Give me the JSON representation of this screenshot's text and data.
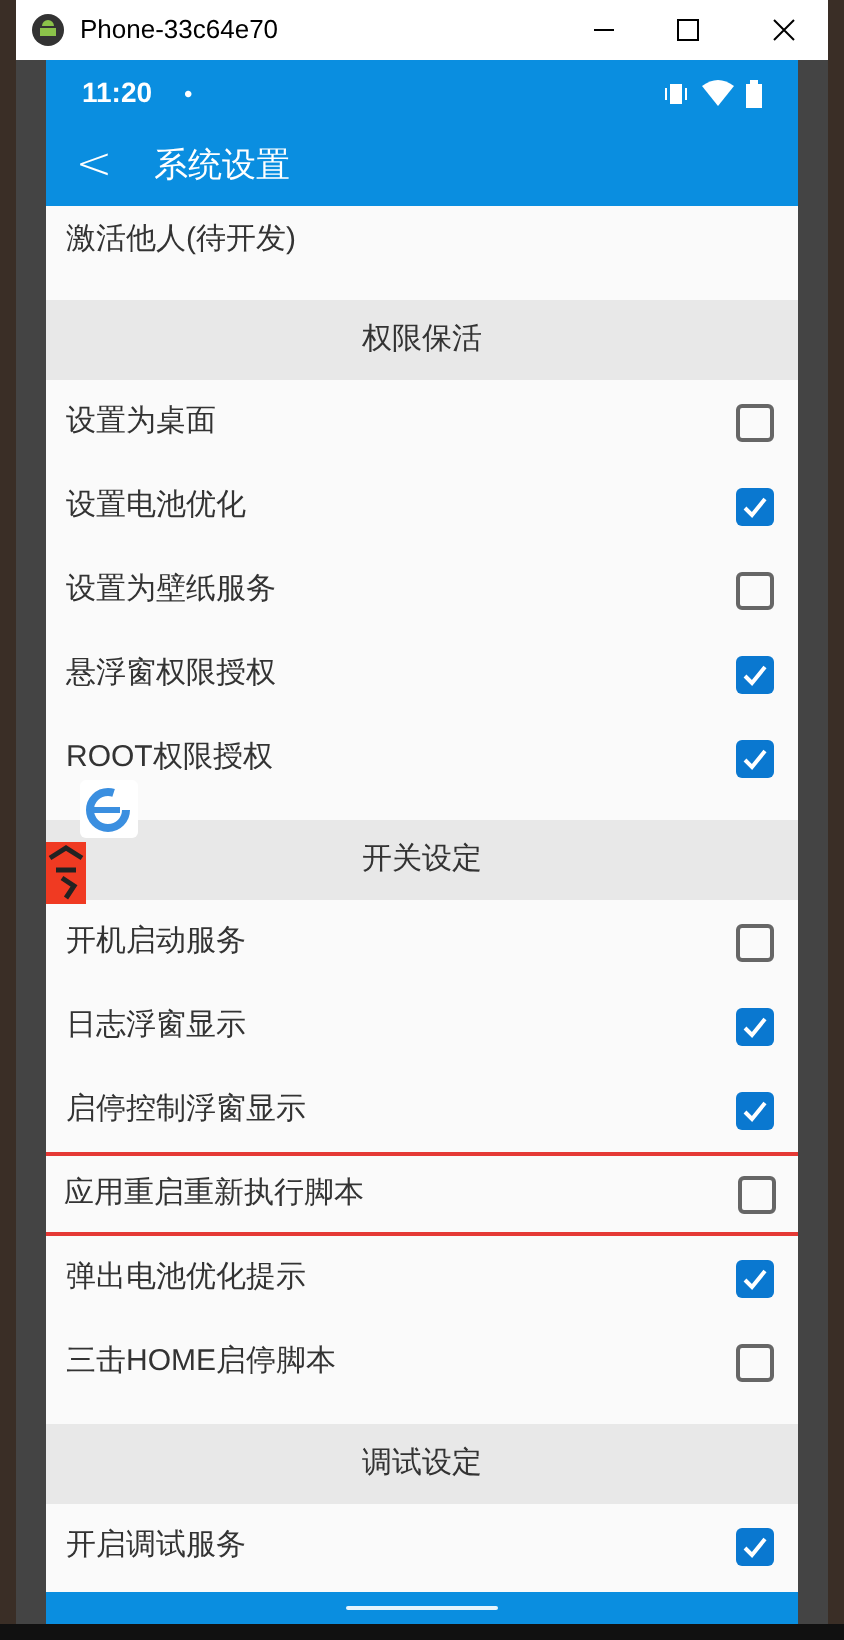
{
  "window": {
    "title": "Phone-33c64e70"
  },
  "status_bar": {
    "time": "11:20",
    "dot": "•"
  },
  "app_bar": {
    "back": "<",
    "title": "系统设置"
  },
  "top_item": {
    "label": "激活他人(待开发)"
  },
  "sections": [
    {
      "title": "权限保活",
      "items": [
        {
          "label": "设置为桌面",
          "checked": false,
          "highlighted": false
        },
        {
          "label": "设置电池优化",
          "checked": true,
          "highlighted": false
        },
        {
          "label": "设置为壁纸服务",
          "checked": false,
          "highlighted": false
        },
        {
          "label": "悬浮窗权限授权",
          "checked": true,
          "highlighted": false
        },
        {
          "label": "ROOT权限授权",
          "checked": true,
          "highlighted": false
        }
      ]
    },
    {
      "title": "开关设定",
      "items": [
        {
          "label": "开机启动服务",
          "checked": false,
          "highlighted": false
        },
        {
          "label": "日志浮窗显示",
          "checked": true,
          "highlighted": false
        },
        {
          "label": "启停控制浮窗显示",
          "checked": true,
          "highlighted": false
        },
        {
          "label": "应用重启重新执行脚本",
          "checked": false,
          "highlighted": true
        },
        {
          "label": "弹出电池优化提示",
          "checked": true,
          "highlighted": false
        },
        {
          "label": "三击HOME启停脚本",
          "checked": false,
          "highlighted": false
        }
      ]
    },
    {
      "title": "调试设定",
      "items": [
        {
          "label": "开启调试服务",
          "checked": true,
          "highlighted": false
        }
      ]
    }
  ]
}
